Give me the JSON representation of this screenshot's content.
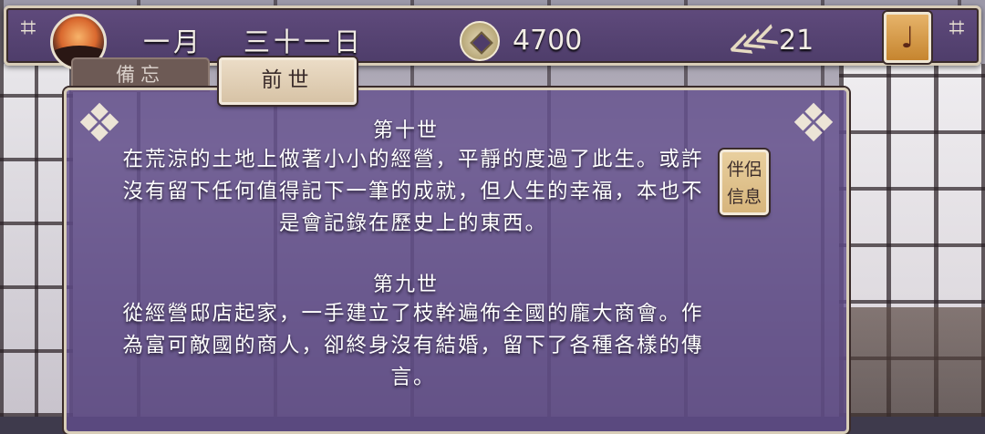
{
  "header": {
    "month": "一月",
    "day": "三十一日",
    "money": "4700",
    "fish_count": "21"
  },
  "tabs": {
    "memo": "備忘",
    "past_life": "前世"
  },
  "lives": [
    {
      "title": "第十世",
      "text": "在荒涼的土地上做著小小的經營，平靜的度過了此生。或許沒有留下任何值得記下一筆的成就，但人生的幸福，本也不是會記錄在歷史上的東西。"
    },
    {
      "title": "第九世",
      "text": "從經營邸店起家，一手建立了枝幹遍佈全國的龐大商會。作為富可敵國的商人，卻終身沒有結婚，留下了各種各樣的傳言。"
    }
  ],
  "partner_button": {
    "line1": "伴侶",
    "line2": "信息"
  },
  "icons": {
    "sun": "sunset-emblem-icon",
    "coin": "coin-icon",
    "fish": "fish-icon",
    "pipa": "pipa-icon",
    "corner": "lattice-corner-icon"
  },
  "colors": {
    "panel": "#624e8c",
    "frame": "#d8cdb8",
    "button": "#d7b57c"
  }
}
